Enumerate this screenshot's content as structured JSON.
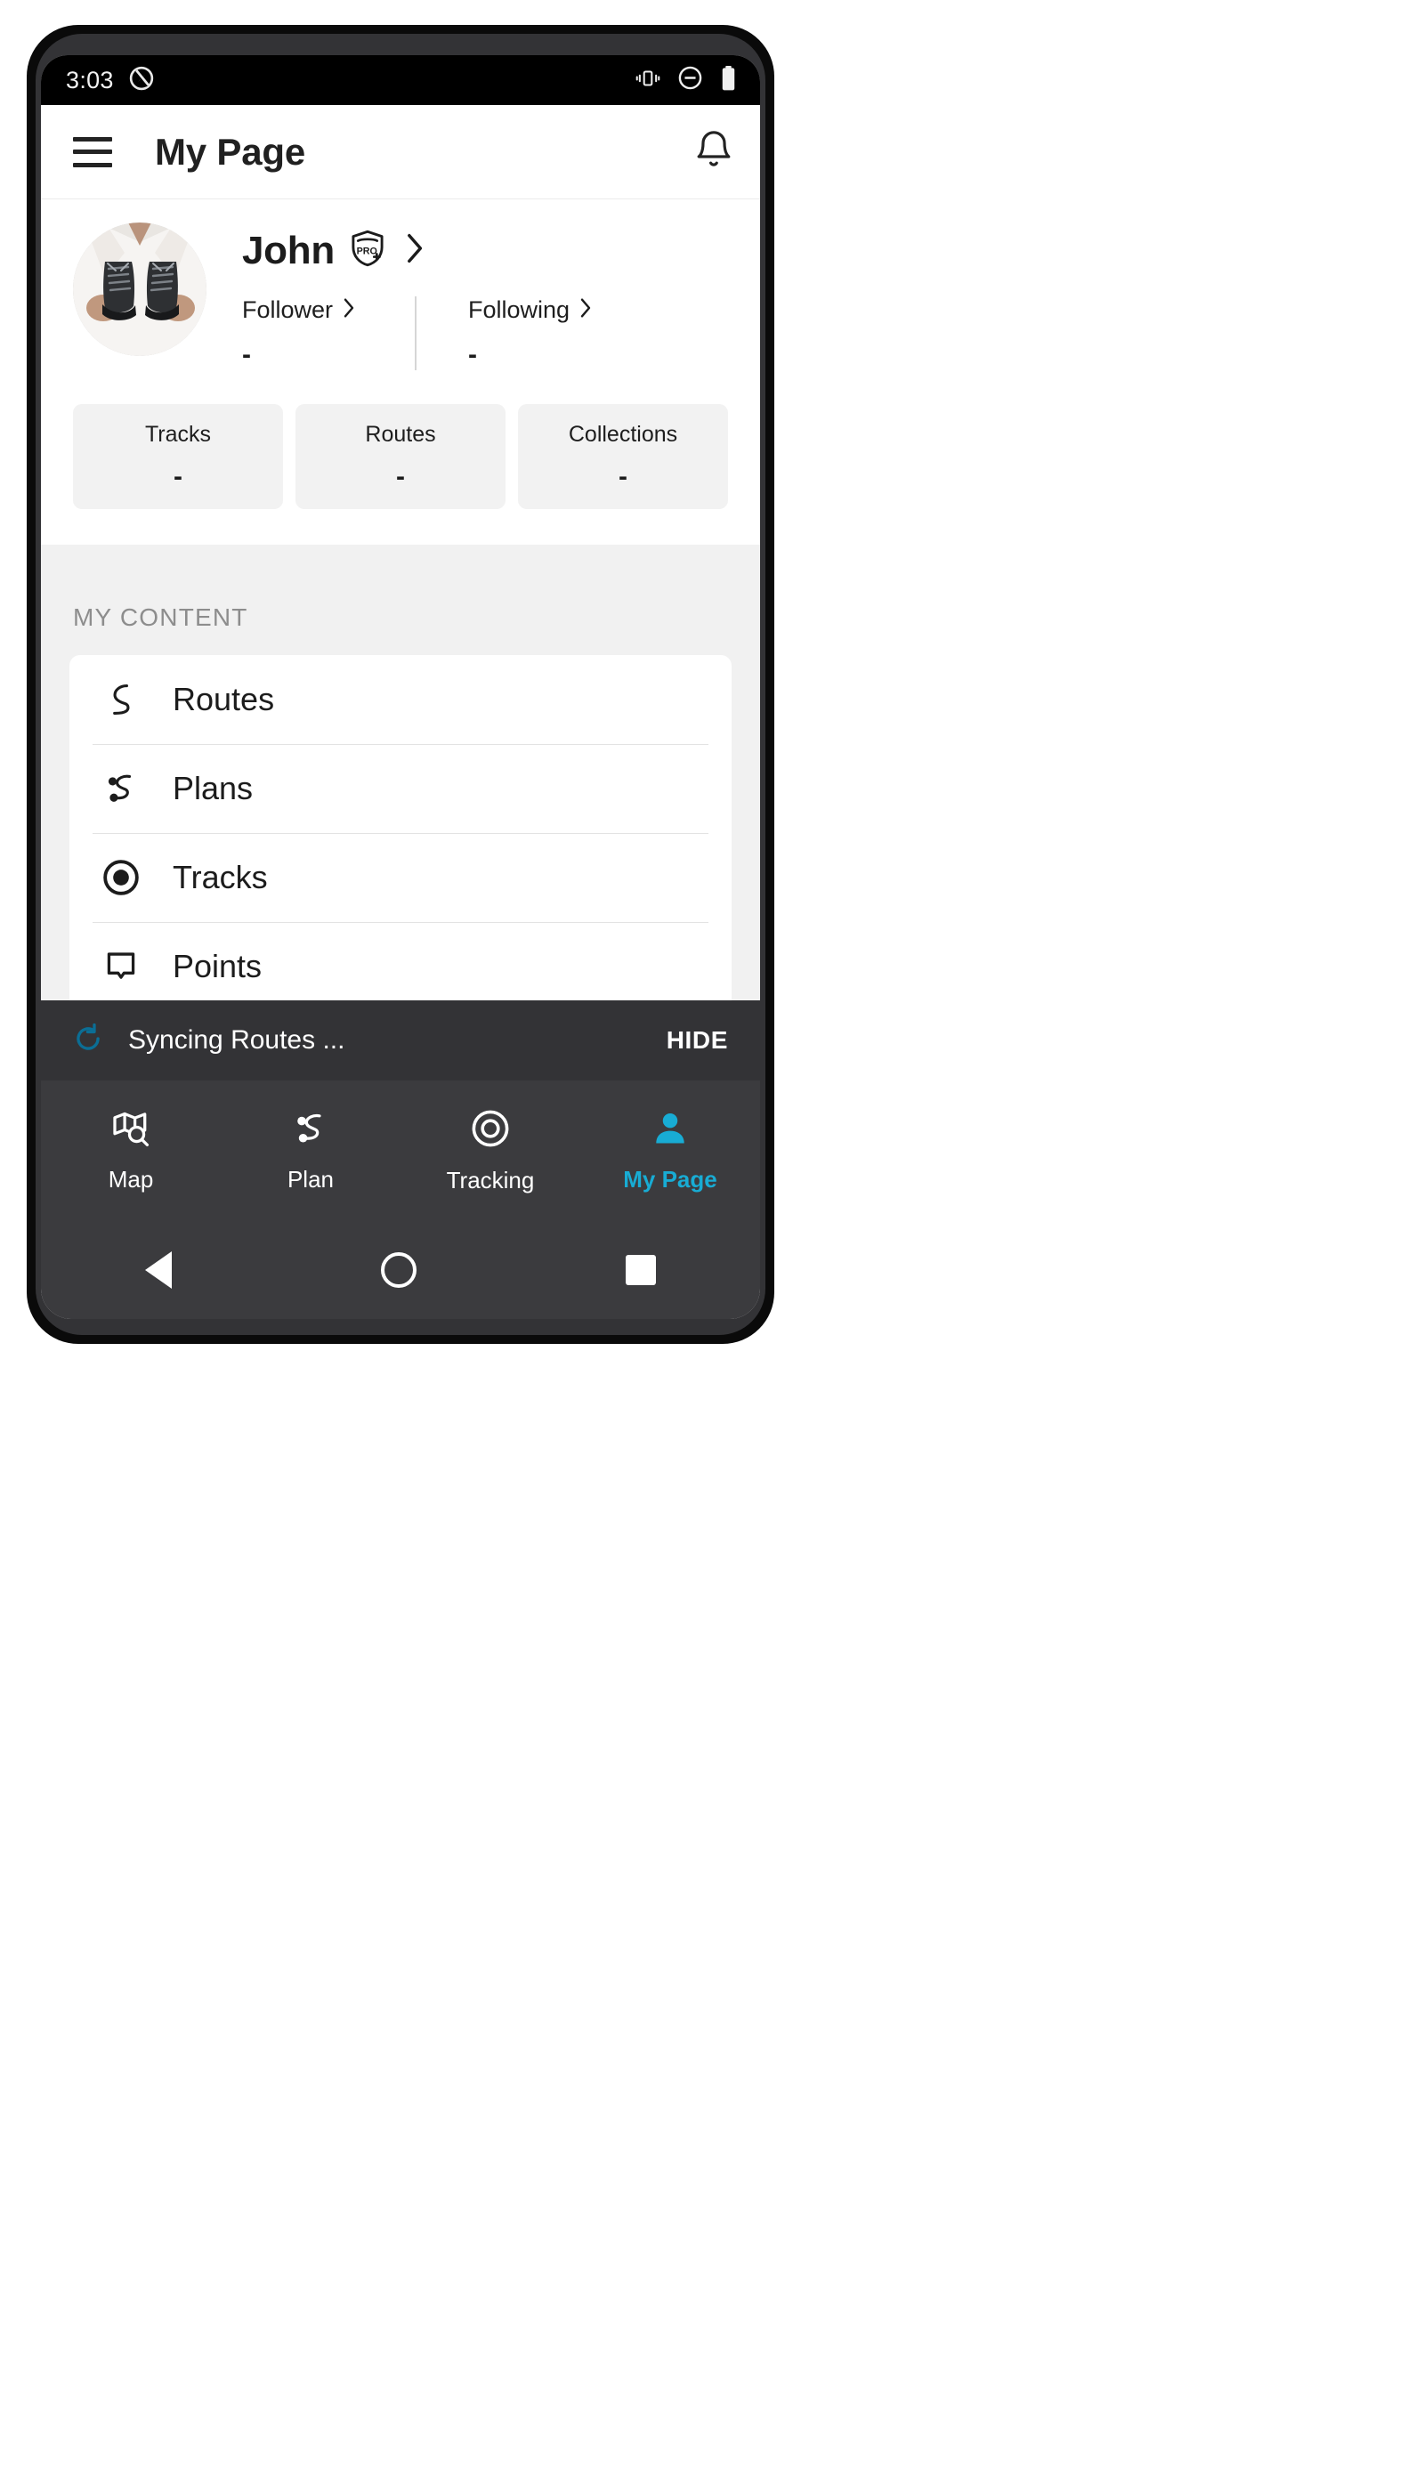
{
  "status_bar": {
    "time": "3:03",
    "left_icons": [
      "location-off-icon"
    ],
    "right_icons": [
      "vibrate-icon",
      "do-not-disturb-icon",
      "battery-icon"
    ]
  },
  "app_bar": {
    "menu_icon": "hamburger-menu-icon",
    "title": "My Page",
    "notification_icon": "bell-icon"
  },
  "profile": {
    "avatar_alt": "hiking-boots-photo",
    "name": "John",
    "badge": "PRO",
    "chevron": "›",
    "stats": [
      {
        "label": "Follower",
        "value": "-",
        "chevron": "›"
      },
      {
        "label": "Following",
        "value": "-",
        "chevron": "›"
      }
    ]
  },
  "cards": [
    {
      "label": "Tracks",
      "value": "-"
    },
    {
      "label": "Routes",
      "value": "-"
    },
    {
      "label": "Collections",
      "value": "-"
    }
  ],
  "content_section": {
    "title": "MY CONTENT",
    "items": [
      {
        "label": "Routes",
        "icon": "route-icon"
      },
      {
        "label": "Plans",
        "icon": "plan-icon"
      },
      {
        "label": "Tracks",
        "icon": "track-record-icon"
      },
      {
        "label": "Points",
        "icon": "point-marker-icon"
      }
    ]
  },
  "sync_bar": {
    "icon": "refresh-icon",
    "icon_color": "#0B6E95",
    "message": "Syncing Routes ...",
    "hide_label": "HIDE"
  },
  "bottom_nav": {
    "active_color": "#18ACD4",
    "items": [
      {
        "label": "Map",
        "icon": "map-search-icon",
        "active": false
      },
      {
        "label": "Plan",
        "icon": "plan-icon",
        "active": false
      },
      {
        "label": "Tracking",
        "icon": "tracking-icon",
        "active": false
      },
      {
        "label": "My Page",
        "icon": "person-icon",
        "active": true
      }
    ]
  },
  "android_nav": {
    "back": "back-triangle-icon",
    "home": "home-circle-icon",
    "recents": "recents-square-icon"
  }
}
